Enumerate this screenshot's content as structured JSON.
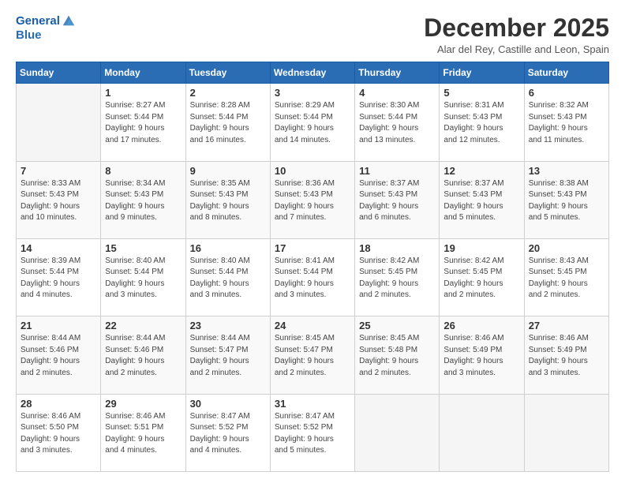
{
  "logo": {
    "line1": "General",
    "line2": "Blue"
  },
  "title": "December 2025",
  "location": "Alar del Rey, Castille and Leon, Spain",
  "weekdays": [
    "Sunday",
    "Monday",
    "Tuesday",
    "Wednesday",
    "Thursday",
    "Friday",
    "Saturday"
  ],
  "weeks": [
    [
      {
        "day": "",
        "sunrise": "",
        "sunset": "",
        "daylight": "",
        "empty": true
      },
      {
        "day": "1",
        "sunrise": "Sunrise: 8:27 AM",
        "sunset": "Sunset: 5:44 PM",
        "daylight": "Daylight: 9 hours and 17 minutes."
      },
      {
        "day": "2",
        "sunrise": "Sunrise: 8:28 AM",
        "sunset": "Sunset: 5:44 PM",
        "daylight": "Daylight: 9 hours and 16 minutes."
      },
      {
        "day": "3",
        "sunrise": "Sunrise: 8:29 AM",
        "sunset": "Sunset: 5:44 PM",
        "daylight": "Daylight: 9 hours and 14 minutes."
      },
      {
        "day": "4",
        "sunrise": "Sunrise: 8:30 AM",
        "sunset": "Sunset: 5:44 PM",
        "daylight": "Daylight: 9 hours and 13 minutes."
      },
      {
        "day": "5",
        "sunrise": "Sunrise: 8:31 AM",
        "sunset": "Sunset: 5:43 PM",
        "daylight": "Daylight: 9 hours and 12 minutes."
      },
      {
        "day": "6",
        "sunrise": "Sunrise: 8:32 AM",
        "sunset": "Sunset: 5:43 PM",
        "daylight": "Daylight: 9 hours and 11 minutes."
      }
    ],
    [
      {
        "day": "7",
        "sunrise": "Sunrise: 8:33 AM",
        "sunset": "Sunset: 5:43 PM",
        "daylight": "Daylight: 9 hours and 10 minutes."
      },
      {
        "day": "8",
        "sunrise": "Sunrise: 8:34 AM",
        "sunset": "Sunset: 5:43 PM",
        "daylight": "Daylight: 9 hours and 9 minutes."
      },
      {
        "day": "9",
        "sunrise": "Sunrise: 8:35 AM",
        "sunset": "Sunset: 5:43 PM",
        "daylight": "Daylight: 9 hours and 8 minutes."
      },
      {
        "day": "10",
        "sunrise": "Sunrise: 8:36 AM",
        "sunset": "Sunset: 5:43 PM",
        "daylight": "Daylight: 9 hours and 7 minutes."
      },
      {
        "day": "11",
        "sunrise": "Sunrise: 8:37 AM",
        "sunset": "Sunset: 5:43 PM",
        "daylight": "Daylight: 9 hours and 6 minutes."
      },
      {
        "day": "12",
        "sunrise": "Sunrise: 8:37 AM",
        "sunset": "Sunset: 5:43 PM",
        "daylight": "Daylight: 9 hours and 5 minutes."
      },
      {
        "day": "13",
        "sunrise": "Sunrise: 8:38 AM",
        "sunset": "Sunset: 5:43 PM",
        "daylight": "Daylight: 9 hours and 5 minutes."
      }
    ],
    [
      {
        "day": "14",
        "sunrise": "Sunrise: 8:39 AM",
        "sunset": "Sunset: 5:44 PM",
        "daylight": "Daylight: 9 hours and 4 minutes."
      },
      {
        "day": "15",
        "sunrise": "Sunrise: 8:40 AM",
        "sunset": "Sunset: 5:44 PM",
        "daylight": "Daylight: 9 hours and 3 minutes."
      },
      {
        "day": "16",
        "sunrise": "Sunrise: 8:40 AM",
        "sunset": "Sunset: 5:44 PM",
        "daylight": "Daylight: 9 hours and 3 minutes."
      },
      {
        "day": "17",
        "sunrise": "Sunrise: 8:41 AM",
        "sunset": "Sunset: 5:44 PM",
        "daylight": "Daylight: 9 hours and 3 minutes."
      },
      {
        "day": "18",
        "sunrise": "Sunrise: 8:42 AM",
        "sunset": "Sunset: 5:45 PM",
        "daylight": "Daylight: 9 hours and 2 minutes."
      },
      {
        "day": "19",
        "sunrise": "Sunrise: 8:42 AM",
        "sunset": "Sunset: 5:45 PM",
        "daylight": "Daylight: 9 hours and 2 minutes."
      },
      {
        "day": "20",
        "sunrise": "Sunrise: 8:43 AM",
        "sunset": "Sunset: 5:45 PM",
        "daylight": "Daylight: 9 hours and 2 minutes."
      }
    ],
    [
      {
        "day": "21",
        "sunrise": "Sunrise: 8:44 AM",
        "sunset": "Sunset: 5:46 PM",
        "daylight": "Daylight: 9 hours and 2 minutes."
      },
      {
        "day": "22",
        "sunrise": "Sunrise: 8:44 AM",
        "sunset": "Sunset: 5:46 PM",
        "daylight": "Daylight: 9 hours and 2 minutes."
      },
      {
        "day": "23",
        "sunrise": "Sunrise: 8:44 AM",
        "sunset": "Sunset: 5:47 PM",
        "daylight": "Daylight: 9 hours and 2 minutes."
      },
      {
        "day": "24",
        "sunrise": "Sunrise: 8:45 AM",
        "sunset": "Sunset: 5:47 PM",
        "daylight": "Daylight: 9 hours and 2 minutes."
      },
      {
        "day": "25",
        "sunrise": "Sunrise: 8:45 AM",
        "sunset": "Sunset: 5:48 PM",
        "daylight": "Daylight: 9 hours and 2 minutes."
      },
      {
        "day": "26",
        "sunrise": "Sunrise: 8:46 AM",
        "sunset": "Sunset: 5:49 PM",
        "daylight": "Daylight: 9 hours and 3 minutes."
      },
      {
        "day": "27",
        "sunrise": "Sunrise: 8:46 AM",
        "sunset": "Sunset: 5:49 PM",
        "daylight": "Daylight: 9 hours and 3 minutes."
      }
    ],
    [
      {
        "day": "28",
        "sunrise": "Sunrise: 8:46 AM",
        "sunset": "Sunset: 5:50 PM",
        "daylight": "Daylight: 9 hours and 3 minutes."
      },
      {
        "day": "29",
        "sunrise": "Sunrise: 8:46 AM",
        "sunset": "Sunset: 5:51 PM",
        "daylight": "Daylight: 9 hours and 4 minutes."
      },
      {
        "day": "30",
        "sunrise": "Sunrise: 8:47 AM",
        "sunset": "Sunset: 5:52 PM",
        "daylight": "Daylight: 9 hours and 4 minutes."
      },
      {
        "day": "31",
        "sunrise": "Sunrise: 8:47 AM",
        "sunset": "Sunset: 5:52 PM",
        "daylight": "Daylight: 9 hours and 5 minutes."
      },
      {
        "day": "",
        "sunrise": "",
        "sunset": "",
        "daylight": "",
        "empty": true
      },
      {
        "day": "",
        "sunrise": "",
        "sunset": "",
        "daylight": "",
        "empty": true
      },
      {
        "day": "",
        "sunrise": "",
        "sunset": "",
        "daylight": "",
        "empty": true
      }
    ]
  ]
}
